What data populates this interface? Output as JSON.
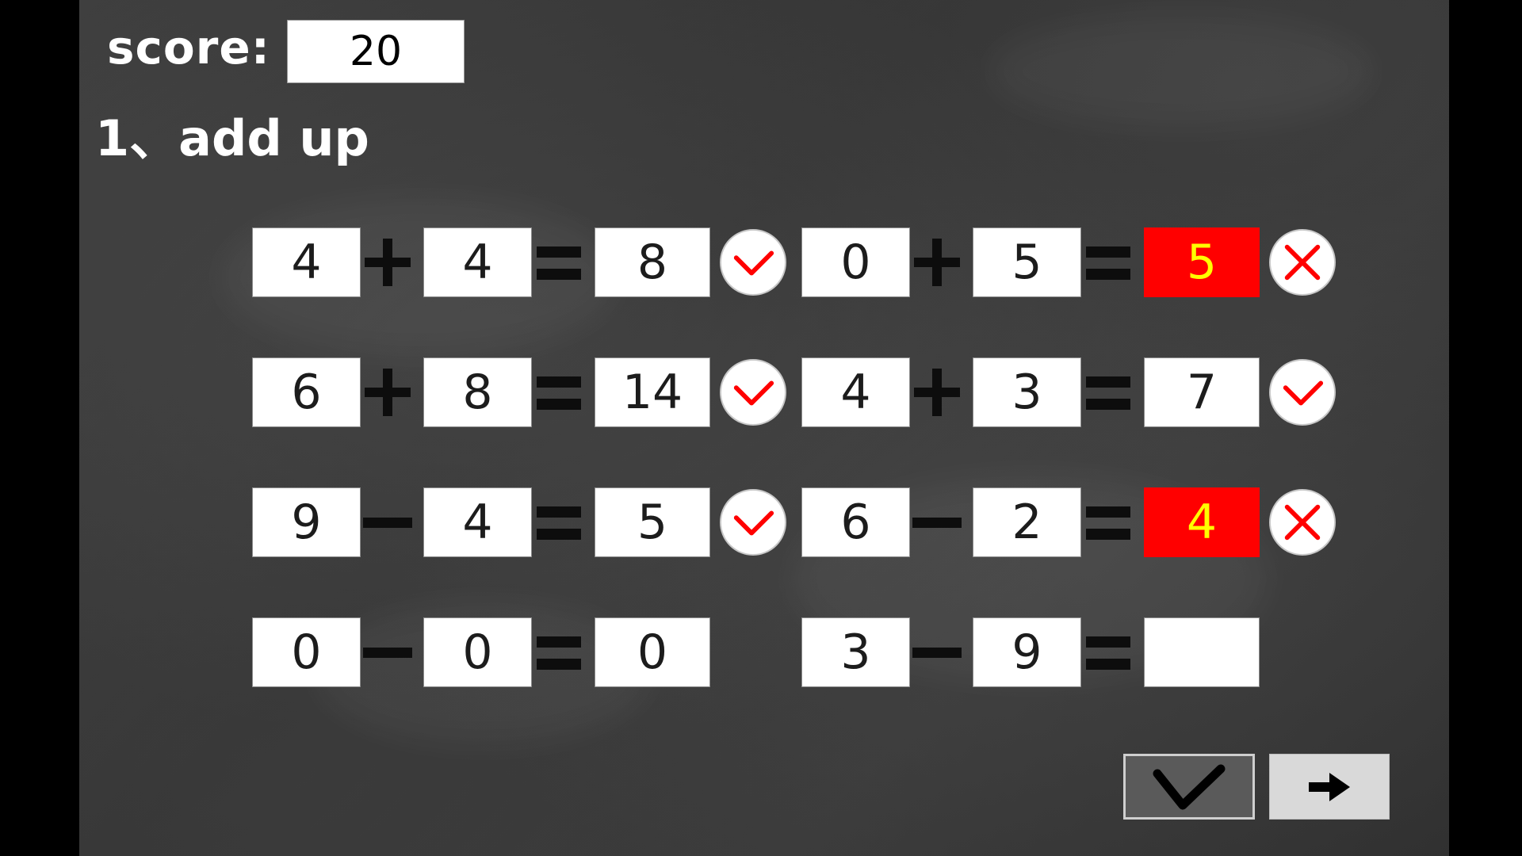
{
  "header": {
    "score_label": "score:",
    "score_value": "20",
    "section_title": "1、add up"
  },
  "colors": {
    "correct_mark": "#ff0000",
    "wrong_mark": "#ff0000",
    "wrong_answer_bg": "#ff0000",
    "wrong_answer_text": "#ffff00",
    "board": "#3a3a3a"
  },
  "problems": [
    {
      "a": "4",
      "op": "plus",
      "b": "4",
      "answer": "8",
      "status": "correct"
    },
    {
      "a": "0",
      "op": "plus",
      "b": "5",
      "answer": "5",
      "status": "wrong"
    },
    {
      "a": "6",
      "op": "plus",
      "b": "8",
      "answer": "14",
      "status": "correct"
    },
    {
      "a": "4",
      "op": "plus",
      "b": "3",
      "answer": "7",
      "status": "correct"
    },
    {
      "a": "9",
      "op": "minus",
      "b": "4",
      "answer": "5",
      "status": "correct"
    },
    {
      "a": "6",
      "op": "minus",
      "b": "2",
      "answer": "4",
      "status": "wrong"
    },
    {
      "a": "0",
      "op": "minus",
      "b": "0",
      "answer": "0",
      "status": "none"
    },
    {
      "a": "3",
      "op": "minus",
      "b": "9",
      "answer": "",
      "status": "none"
    }
  ],
  "controls": {
    "check_icon": "checkmark-icon",
    "next_icon": "arrow-right-icon"
  }
}
